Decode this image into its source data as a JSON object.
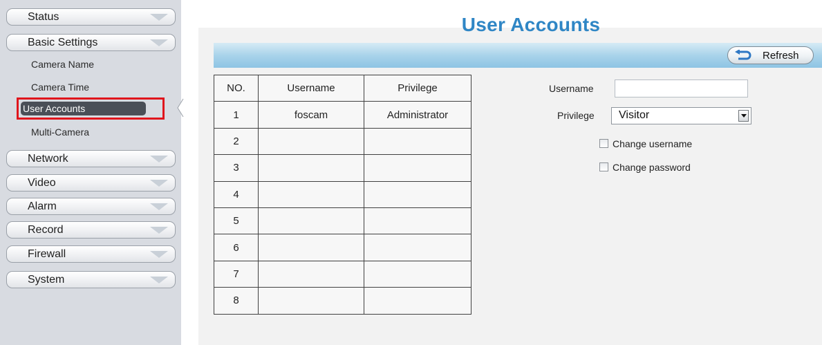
{
  "sidebar": {
    "groups": [
      {
        "label": "Status"
      },
      {
        "label": "Basic Settings"
      },
      {
        "label": "Network"
      },
      {
        "label": "Video"
      },
      {
        "label": "Alarm"
      },
      {
        "label": "Record"
      },
      {
        "label": "Firewall"
      },
      {
        "label": "System"
      }
    ],
    "basic_settings_items": [
      {
        "label": "Camera Name"
      },
      {
        "label": "Camera Time"
      },
      {
        "label": "User Accounts",
        "active": true
      },
      {
        "label": "Multi-Camera"
      }
    ]
  },
  "page": {
    "title": "User Accounts",
    "refresh_label": "Refresh"
  },
  "table": {
    "headers": [
      "NO.",
      "Username",
      "Privilege"
    ],
    "rows": [
      [
        "1",
        "foscam",
        "Administrator"
      ],
      [
        "2",
        "",
        ""
      ],
      [
        "3",
        "",
        ""
      ],
      [
        "4",
        "",
        ""
      ],
      [
        "5",
        "",
        ""
      ],
      [
        "6",
        "",
        ""
      ],
      [
        "7",
        "",
        ""
      ],
      [
        "8",
        "",
        ""
      ]
    ]
  },
  "form": {
    "username_label": "Username",
    "username_value": "",
    "privilege_label": "Privilege",
    "privilege_value": "Visitor",
    "change_username_label": "Change username",
    "change_password_label": "Change password"
  },
  "colors": {
    "title": "#2f86c5",
    "active_highlight": "#e0151c",
    "header_bar": "#a9d3ea",
    "sidebar_bg": "#d8dbe1"
  }
}
